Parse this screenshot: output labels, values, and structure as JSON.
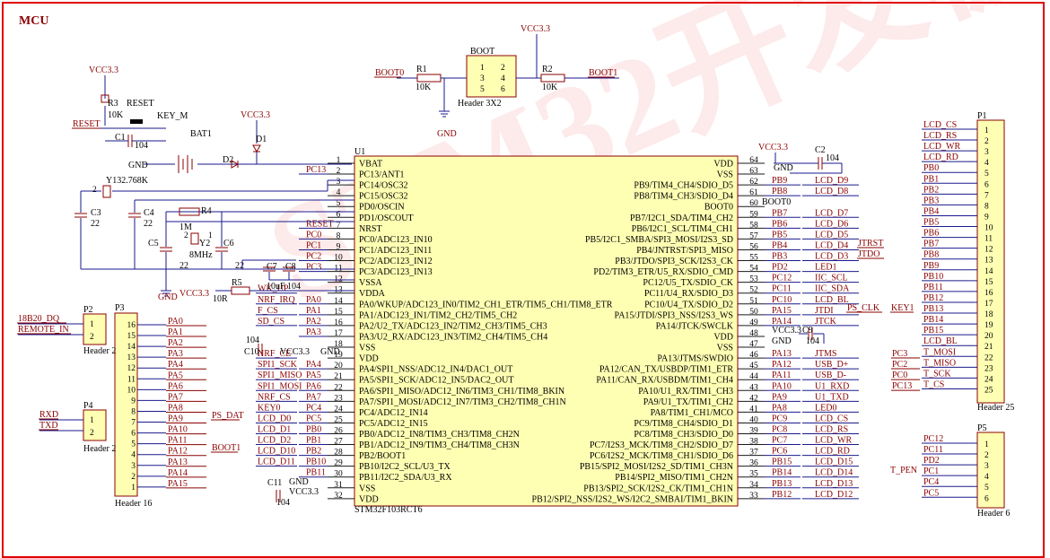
{
  "sheet_title": "MCU",
  "u1": {
    "ref": "U1",
    "part": "STM32F103RCT6",
    "left_pins": [
      {
        "num": "1",
        "name": "VBAT",
        "net": ""
      },
      {
        "num": "2",
        "name": "PC13/ANT1",
        "net": "PC13"
      },
      {
        "num": "3",
        "name": "PC14/OSC32",
        "net": ""
      },
      {
        "num": "4",
        "name": "PC15/OSC32",
        "net": ""
      },
      {
        "num": "5",
        "name": "PD0/OSCIN",
        "net": ""
      },
      {
        "num": "6",
        "name": "PD1/OSCOUT",
        "net": ""
      },
      {
        "num": "7",
        "name": "NRST",
        "net": "RESET"
      },
      {
        "num": "8",
        "name": "PC0/ADC123_IN10",
        "net": "PC0"
      },
      {
        "num": "9",
        "name": "PC1/ADC123_IN11",
        "net": "PC1"
      },
      {
        "num": "10",
        "name": "PC2/ADC123_IN12",
        "net": "PC2"
      },
      {
        "num": "11",
        "name": "PC3/ADC123_IN13",
        "net": "PC3"
      },
      {
        "num": "12",
        "name": "VSSA",
        "net": ""
      },
      {
        "num": "13",
        "name": "VDDA",
        "net": ""
      },
      {
        "num": "14",
        "name": "PA0/WKUP/ADC123_IN0/TIM2_CH1_ETR/TIM5_CH1/TIM8_ETR",
        "net": "PA0"
      },
      {
        "num": "15",
        "name": "PA1/ADC123_IN1/TIM2_CH2/TIM5_CH2",
        "net": "PA1"
      },
      {
        "num": "16",
        "name": "PA2/U2_TX/ADC123_IN2/TIM2_CH3/TIM5_CH3",
        "net": "PA2"
      },
      {
        "num": "17",
        "name": "PA3/U2_RX/ADC123_IN3/TIM2_CH4/TIM5_CH4",
        "net": "PA3"
      },
      {
        "num": "18",
        "name": "VSS",
        "net": "GND"
      },
      {
        "num": "19",
        "name": "VDD",
        "net": "VCC3.3"
      },
      {
        "num": "20",
        "name": "PA4/SPI1_NSS/ADC12_IN4/DAC1_OUT",
        "net": "PA4"
      },
      {
        "num": "21",
        "name": "PA5/SPI1_SCK/ADC12_IN5/DAC2_OUT",
        "net": "PA5"
      },
      {
        "num": "22",
        "name": "PA6/SPI1_MISO/ADC12_IN6/TIM3_CH1/TIM8_BKIN",
        "net": "PA6"
      },
      {
        "num": "23",
        "name": "PA7/SPI1_MOSI/ADC12_IN7/TIM3_CH2/TIM8_CH1N",
        "net": "PA7"
      },
      {
        "num": "24",
        "name": "PC4/ADC12_IN14",
        "net": "PC4"
      },
      {
        "num": "25",
        "name": "PC5/ADC12_IN15",
        "net": "PC5"
      },
      {
        "num": "26",
        "name": "PB0/ADC12_IN8/TIM3_CH3/TIM8_CH2N",
        "net": "PB0"
      },
      {
        "num": "27",
        "name": "PB1/ADC12_IN9/TIM3_CH4/TIM8_CH3N",
        "net": "PB1"
      },
      {
        "num": "28",
        "name": "PB2/BOOT1",
        "net": "PB2"
      },
      {
        "num": "29",
        "name": "PB10/I2C2_SCL/U3_TX",
        "net": "PB10"
      },
      {
        "num": "30",
        "name": "PB11/I2C2_SDA/U3_RX",
        "net": "PB11"
      },
      {
        "num": "31",
        "name": "VSS",
        "net": "GND"
      },
      {
        "num": "32",
        "name": "VDD",
        "net": "VCC3.3"
      }
    ],
    "right_pins": [
      {
        "num": "64",
        "name": "VDD",
        "net": "VCC3.3"
      },
      {
        "num": "63",
        "name": "VSS",
        "net": "GND"
      },
      {
        "num": "62",
        "name": "PB9/TIM4_CH4/SDIO_D5",
        "net": "PB9"
      },
      {
        "num": "61",
        "name": "PB8/TIM4_CH3/SDIO_D4",
        "net": "PB8"
      },
      {
        "num": "60",
        "name": "BOOT0",
        "net": "BOOT0"
      },
      {
        "num": "59",
        "name": "PB7/I2C1_SDA/TIM4_CH2",
        "net": "PB7"
      },
      {
        "num": "58",
        "name": "PB6/I2C1_SCL/TIM4_CH1",
        "net": "PB6"
      },
      {
        "num": "57",
        "name": "PB5/I2C1_SMBA/SPI3_MOSI/I2S3_SD",
        "net": "PB5"
      },
      {
        "num": "56",
        "name": "PB4/JNTRST/SPI3_MISO",
        "net": "PB4"
      },
      {
        "num": "55",
        "name": "PB3/JTDO/SPI3_SCK/I2S3_CK",
        "net": "PB3"
      },
      {
        "num": "54",
        "name": "PD2/TIM3_ETR/U5_RX/SDIO_CMD",
        "net": "PD2"
      },
      {
        "num": "53",
        "name": "PC12/U5_TX/SDIO_CK",
        "net": "PC12"
      },
      {
        "num": "52",
        "name": "PC11/U4_RX/SDIO_D3",
        "net": "PC11"
      },
      {
        "num": "51",
        "name": "PC10/U4_TX/SDIO_D2",
        "net": "PC10"
      },
      {
        "num": "50",
        "name": "PA15/JTDI/SPI3_NSS/I2S3_WS",
        "net": "PA15"
      },
      {
        "num": "49",
        "name": "PA14/JTCK/SWCLK",
        "net": "PA14"
      },
      {
        "num": "48",
        "name": "VDD",
        "net": "VCC3.3"
      },
      {
        "num": "47",
        "name": "VSS",
        "net": "GND"
      },
      {
        "num": "46",
        "name": "PA13/JTMS/SWDIO",
        "net": "PA13"
      },
      {
        "num": "45",
        "name": "PA12/CAN_TX/USBDP/TIM1_ETR",
        "net": "PA12"
      },
      {
        "num": "44",
        "name": "PA11/CAN_RX/USBDM/TIM1_CH4",
        "net": "PA11"
      },
      {
        "num": "43",
        "name": "PA10/U1_RX/TIM1_CH3",
        "net": "PA10"
      },
      {
        "num": "42",
        "name": "PA9/U1_TX/TIM1_CH2",
        "net": "PA9"
      },
      {
        "num": "41",
        "name": "PA8/TIM1_CH1/MCO",
        "net": "PA8"
      },
      {
        "num": "40",
        "name": "PC9/TIM8_CH4/SDIO_D1",
        "net": "PC9"
      },
      {
        "num": "39",
        "name": "PC8/TIM8_CH3/SDIO_D0",
        "net": "PC8"
      },
      {
        "num": "38",
        "name": "PC7/I2S3_MCK/TIM8_CH2/SDIO_D7",
        "net": "PC7"
      },
      {
        "num": "37",
        "name": "PC6/I2S2_MCK/TIM8_CH1/SDIO_D6",
        "net": "PC6"
      },
      {
        "num": "36",
        "name": "PB15/SPI2_MOSI/I2S2_SD/TIM1_CH3N",
        "net": "PB15"
      },
      {
        "num": "35",
        "name": "PB14/SPI2_MISO/TIM1_CH2N",
        "net": "PB14"
      },
      {
        "num": "34",
        "name": "PB13/SPI2_SCK/I2S2_CK/TIM1_CH1N",
        "net": "PB13"
      },
      {
        "num": "33",
        "name": "PB12/SPI2_NSS/I2S2_WS/I2C2_SMBAI/TIM1_BKIN",
        "net": "PB12"
      }
    ],
    "left_sig": [
      "",
      "",
      "",
      "",
      "",
      "",
      "",
      "",
      "",
      "",
      "",
      "",
      "WK_UP",
      "NRF_IRQ",
      "F_CS",
      "SD_CS",
      "",
      "",
      "NRF_CE",
      "SPI1_SCK",
      "SPI1_MISO",
      "SPI1_MOSI",
      "NRF_CS",
      "KEY0",
      "LCD_D0",
      "LCD_D1",
      "LCD_D2",
      "LCD_D10",
      "LCD_D11",
      "",
      "",
      ""
    ],
    "right_sig": [
      "",
      "",
      "LCD_D9",
      "LCD_D8",
      "",
      "LCD_D7",
      "LCD_D6",
      "LCD_D5",
      "LCD_D4",
      "LCD_D3",
      "LED1",
      "IIC_SCL",
      "IIC_SDA",
      "LCD_BL",
      "JTDI",
      "JTCK",
      "",
      "",
      "JTMS",
      "USB_D+",
      "USB_D-",
      "U1_RXD",
      "U1_TXD",
      "LED0",
      "LCD_CS",
      "LCD_RS",
      "LCD_WR",
      "LCD_RD",
      "LCD_D15",
      "LCD_D14",
      "LCD_D13",
      "LCD_D12"
    ]
  },
  "extra_nets": {
    "jtrst": "JTRST",
    "jtdo": "JTDO",
    "ps_clk": "PS_CLK",
    "key1": "KEY1",
    "ps_dat": "PS_DAT",
    "boot1": "BOOT1",
    "boot0": "BOOT0",
    "reset": "RESET",
    "ds": "18B20_DQ",
    "remote": "REMOTE_IN",
    "rxd": "RXD",
    "txd": "TXD",
    "t_pen": "T_PEN"
  },
  "components": {
    "r1": "R1",
    "r1_val": "10K",
    "r2": "R2",
    "r2_val": "10K",
    "r3": "R3",
    "r3_val": "10K",
    "r4": "R4",
    "r5": "R5",
    "r5_val": "10R",
    "boot_hdr": "BOOT",
    "boot_hdr_part": "Header 3X2",
    "boot_pins": [
      "1",
      "2",
      "3",
      "4",
      "5",
      "6"
    ],
    "reset_btn": "RESET",
    "key_m": "KEY_M",
    "bat": "BAT1",
    "d1": "D1",
    "d2": "D2",
    "c1": "C1",
    "c1_val": "104",
    "c2": "C2",
    "c2_val": "104",
    "c3": "C3",
    "c3_val": "22",
    "c4": "C4",
    "c4_val": "22",
    "c5": "C5",
    "c5_val": "22",
    "c6": "C6",
    "c6_val": "22",
    "c7": "C7",
    "c8": "C8",
    "c8_val": "104",
    "c9": "C9",
    "c9_val": "104",
    "c10": "C10",
    "c10_val": "104",
    "c11": "C11",
    "c11_val": "104",
    "c7_val": "10uF",
    "y1": "Y1",
    "y1_val": "32.768K",
    "y2": "Y2",
    "y2_val": "8MHz",
    "y2_1m": "1M"
  },
  "power": {
    "vcc": "VCC3.3",
    "gnd": "GND"
  },
  "p1": {
    "ref": "P1",
    "part": "Header 25",
    "nets": [
      "LCD_CS",
      "LCD_RS",
      "LCD_WR",
      "LCD_RD",
      "PB0",
      "PB1",
      "PB2",
      "PB3",
      "PB4",
      "PB5",
      "PB6",
      "PB7",
      "PB8",
      "PB9",
      "PB10",
      "PB11",
      "PB12",
      "PB13",
      "PB14",
      "PB15",
      "LCD_BL",
      "T_MOSI",
      "T_MISO",
      "T_SCK",
      "T_CS"
    ],
    "side_nets": [
      "PC3",
      "PC2",
      "PC0",
      "PC13"
    ]
  },
  "p2": {
    "ref": "P2",
    "part": "Header 2"
  },
  "p4": {
    "ref": "P4",
    "part": "Header 2"
  },
  "p3": {
    "ref": "P3",
    "part": "Header 16",
    "nums": [
      "16",
      "15",
      "14",
      "13",
      "12",
      "11",
      "10",
      "9",
      "8",
      "7",
      "6",
      "5",
      "4",
      "3",
      "2",
      "1"
    ],
    "nets": [
      "PA0",
      "PA1",
      "PA2",
      "PA3",
      "PA4",
      "PA5",
      "PA6",
      "PA7",
      "PA8",
      "PA9",
      "PA10",
      "PA11",
      "PA12",
      "PA13",
      "PA14",
      "PA15"
    ]
  },
  "p5": {
    "ref": "P5",
    "part": "Header 6",
    "nets": [
      "PC12",
      "PC11",
      "PD2",
      "PC1",
      "PC4",
      "PC5"
    ]
  },
  "watermark": "STM32开发板"
}
